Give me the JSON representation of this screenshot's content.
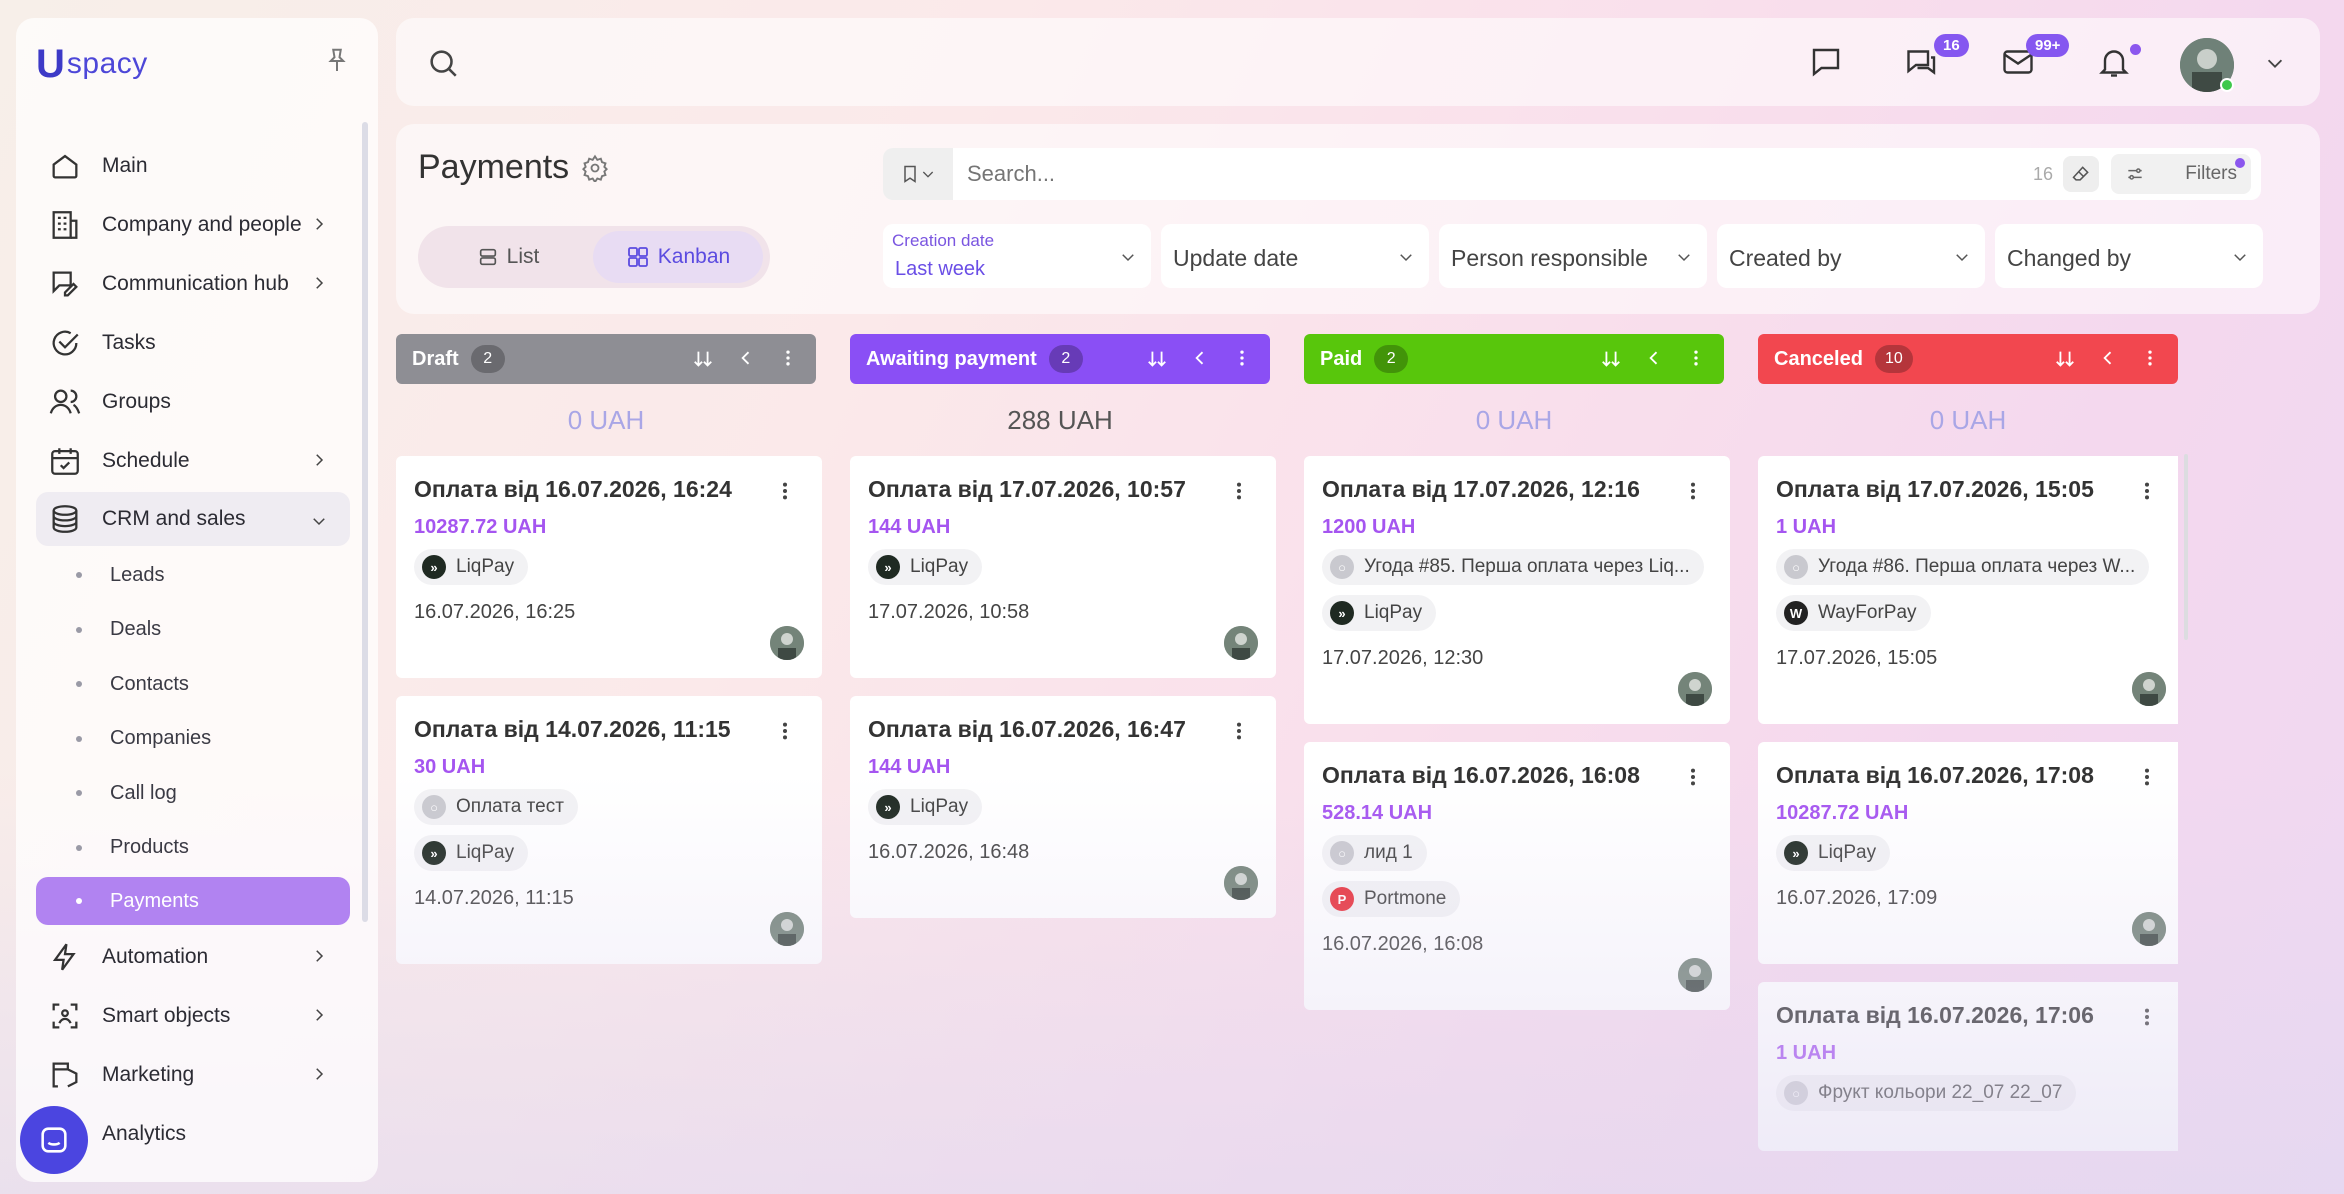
{
  "brand": {
    "logo_u": "U",
    "logo_rest": "spacy"
  },
  "sidebar": {
    "items": [
      {
        "label": "Main",
        "icon": "home-icon",
        "has_arrow": false
      },
      {
        "label": "Company and people",
        "icon": "building-icon",
        "has_arrow": true
      },
      {
        "label": "Communication hub",
        "icon": "chat-edit-icon",
        "has_arrow": true
      },
      {
        "label": "Tasks",
        "icon": "check-circle-icon",
        "has_arrow": false
      },
      {
        "label": "Groups",
        "icon": "users-icon",
        "has_arrow": false
      },
      {
        "label": "Schedule",
        "icon": "calendar-icon",
        "has_arrow": true
      },
      {
        "label": "CRM and sales",
        "icon": "coins-icon",
        "has_arrow": true,
        "open": true
      }
    ],
    "crm_sub": [
      "Leads",
      "Deals",
      "Contacts",
      "Companies",
      "Call log",
      "Products",
      "Payments"
    ],
    "bottom_items": [
      {
        "label": "Automation",
        "icon": "lightning-icon"
      },
      {
        "label": "Smart objects",
        "icon": "scan-icon"
      },
      {
        "label": "Marketing",
        "icon": "megaphone-icon"
      },
      {
        "label": "Analytics",
        "icon": "chart-icon"
      }
    ]
  },
  "topbar": {
    "chat_badge": "16",
    "mail_badge": "99+"
  },
  "page": {
    "title": "Payments",
    "views": {
      "list": "List",
      "kanban": "Kanban"
    },
    "search_placeholder": "Search...",
    "search_count": "16",
    "filters_label": "Filters",
    "filter_selects": [
      {
        "label": "Creation date",
        "value": "Last week"
      },
      {
        "label": "Update date"
      },
      {
        "label": "Person responsible"
      },
      {
        "label": "Created by"
      },
      {
        "label": "Changed by"
      }
    ]
  },
  "colors": {
    "draft": "#8e8e94",
    "awaiting": "#8a4ff5",
    "paid": "#58c60c",
    "canceled": "#f2474f",
    "accent": "#a555f0"
  },
  "columns": [
    {
      "name": "Draft",
      "count": "2",
      "sum": "0 UAH",
      "cards": [
        {
          "title": "Оплата від 16.07.2026, 16:24",
          "amount": "10287.72 UAH",
          "chips": [
            {
              "label": "LiqPay",
              "type": "liqpay"
            }
          ],
          "date": "16.07.2026, 16:25"
        },
        {
          "title": "Оплата від 14.07.2026, 11:15",
          "amount": "30 UAH",
          "chips": [
            {
              "label": "Оплата тест",
              "type": "gray"
            },
            {
              "label": "LiqPay",
              "type": "liqpay"
            }
          ],
          "date": "14.07.2026, 11:15"
        }
      ]
    },
    {
      "name": "Awaiting payment",
      "count": "2",
      "sum": "288 UAH",
      "cards": [
        {
          "title": "Оплата від 17.07.2026, 10:57",
          "amount": "144 UAH",
          "chips": [
            {
              "label": "LiqPay",
              "type": "liqpay"
            }
          ],
          "date": "17.07.2026, 10:58"
        },
        {
          "title": "Оплата від 16.07.2026, 16:47",
          "amount": "144 UAH",
          "chips": [
            {
              "label": "LiqPay",
              "type": "liqpay"
            }
          ],
          "date": "16.07.2026, 16:48"
        }
      ]
    },
    {
      "name": "Paid",
      "count": "2",
      "sum": "0 UAH",
      "cards": [
        {
          "title": "Оплата від 17.07.2026, 12:16",
          "amount": "1200 UAH",
          "chips": [
            {
              "label": "Угода #85. Перша оплата через Liq...",
              "type": "gray"
            },
            {
              "label": "LiqPay",
              "type": "liqpay"
            }
          ],
          "date": "17.07.2026, 12:30"
        },
        {
          "title": "Оплата від 16.07.2026, 16:08",
          "amount": "528.14 UAH",
          "chips": [
            {
              "label": "лид 1",
              "type": "gray"
            },
            {
              "label": "Portmone",
              "type": "portmone"
            }
          ],
          "date": "16.07.2026, 16:08"
        }
      ]
    },
    {
      "name": "Canceled",
      "count": "10",
      "sum": "0 UAH",
      "cards": [
        {
          "title": "Оплата від 17.07.2026, 15:05",
          "amount": "1 UAH",
          "chips": [
            {
              "label": "Угода #86. Перша оплата через W...",
              "type": "gray"
            },
            {
              "label": "WayForPay",
              "type": "wayforpay"
            }
          ],
          "date": "17.07.2026, 15:05"
        },
        {
          "title": "Оплата від 16.07.2026, 17:08",
          "amount": "10287.72 UAH",
          "chips": [
            {
              "label": "LiqPay",
              "type": "liqpay"
            }
          ],
          "date": "16.07.2026, 17:09"
        },
        {
          "title": "Оплата від 16.07.2026, 17:06",
          "amount": "1 UAH",
          "chips": [
            {
              "label": "Фрукт кольори 22_07 22_07",
              "type": "gray"
            }
          ],
          "date": ""
        }
      ]
    }
  ]
}
